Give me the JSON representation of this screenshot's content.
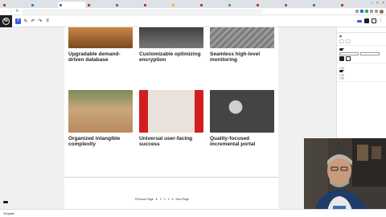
{
  "browser": {
    "tabs": [
      {
        "title": "",
        "color": "#c5221f",
        "active": false
      },
      {
        "title": "",
        "color": "#1a73e8",
        "active": false
      },
      {
        "title": "",
        "color": "#21759b",
        "active": true
      },
      {
        "title": "",
        "color": "#c5221f",
        "active": false
      },
      {
        "title": "",
        "color": "#5f6368",
        "active": false
      },
      {
        "title": "",
        "color": "#c5221f",
        "active": false
      },
      {
        "title": "",
        "color": "#f9ab00",
        "active": false
      },
      {
        "title": "",
        "color": "#c5221f",
        "active": false
      },
      {
        "title": "",
        "color": "#34a853",
        "active": false
      },
      {
        "title": "",
        "color": "#c5221f",
        "active": false
      },
      {
        "title": "",
        "color": "#5f6368",
        "active": false
      },
      {
        "title": "",
        "color": "#1a73e8",
        "active": false
      },
      {
        "title": "",
        "color": "#c5221f",
        "active": false
      }
    ],
    "url": ""
  },
  "editor": {
    "publish_label": "",
    "save_draft_label": "",
    "preview_label": ""
  },
  "posts": [
    {
      "title": "Upgradable demand-driven database",
      "img": "#a86a3a"
    },
    {
      "title": "Customizable optimizing encryption",
      "img": "#5a5a5a"
    },
    {
      "title": "Seamless high-level monitoring",
      "img": "#8c8c8c"
    },
    {
      "title": "Organized intangible complexity",
      "img": "#c9a77a"
    },
    {
      "title": "Universal user-facing success",
      "img": "#d11f1f"
    },
    {
      "title": "Quality-focused incremental portal",
      "img": "#555555"
    }
  ],
  "pagination": {
    "previous": "Previous Page",
    "pages": [
      "1",
      "2",
      "3",
      "4",
      "5"
    ],
    "next": "Next Page"
  },
  "panel": {
    "tab_post": "",
    "tab_block": "",
    "sections": []
  },
  "status": {
    "breadcrumb": "Template",
    "save_toast": ""
  },
  "colors": {
    "accent": "#3858e9",
    "wp_dark": "#1e1e1e",
    "chrome": "#dee1e6"
  }
}
